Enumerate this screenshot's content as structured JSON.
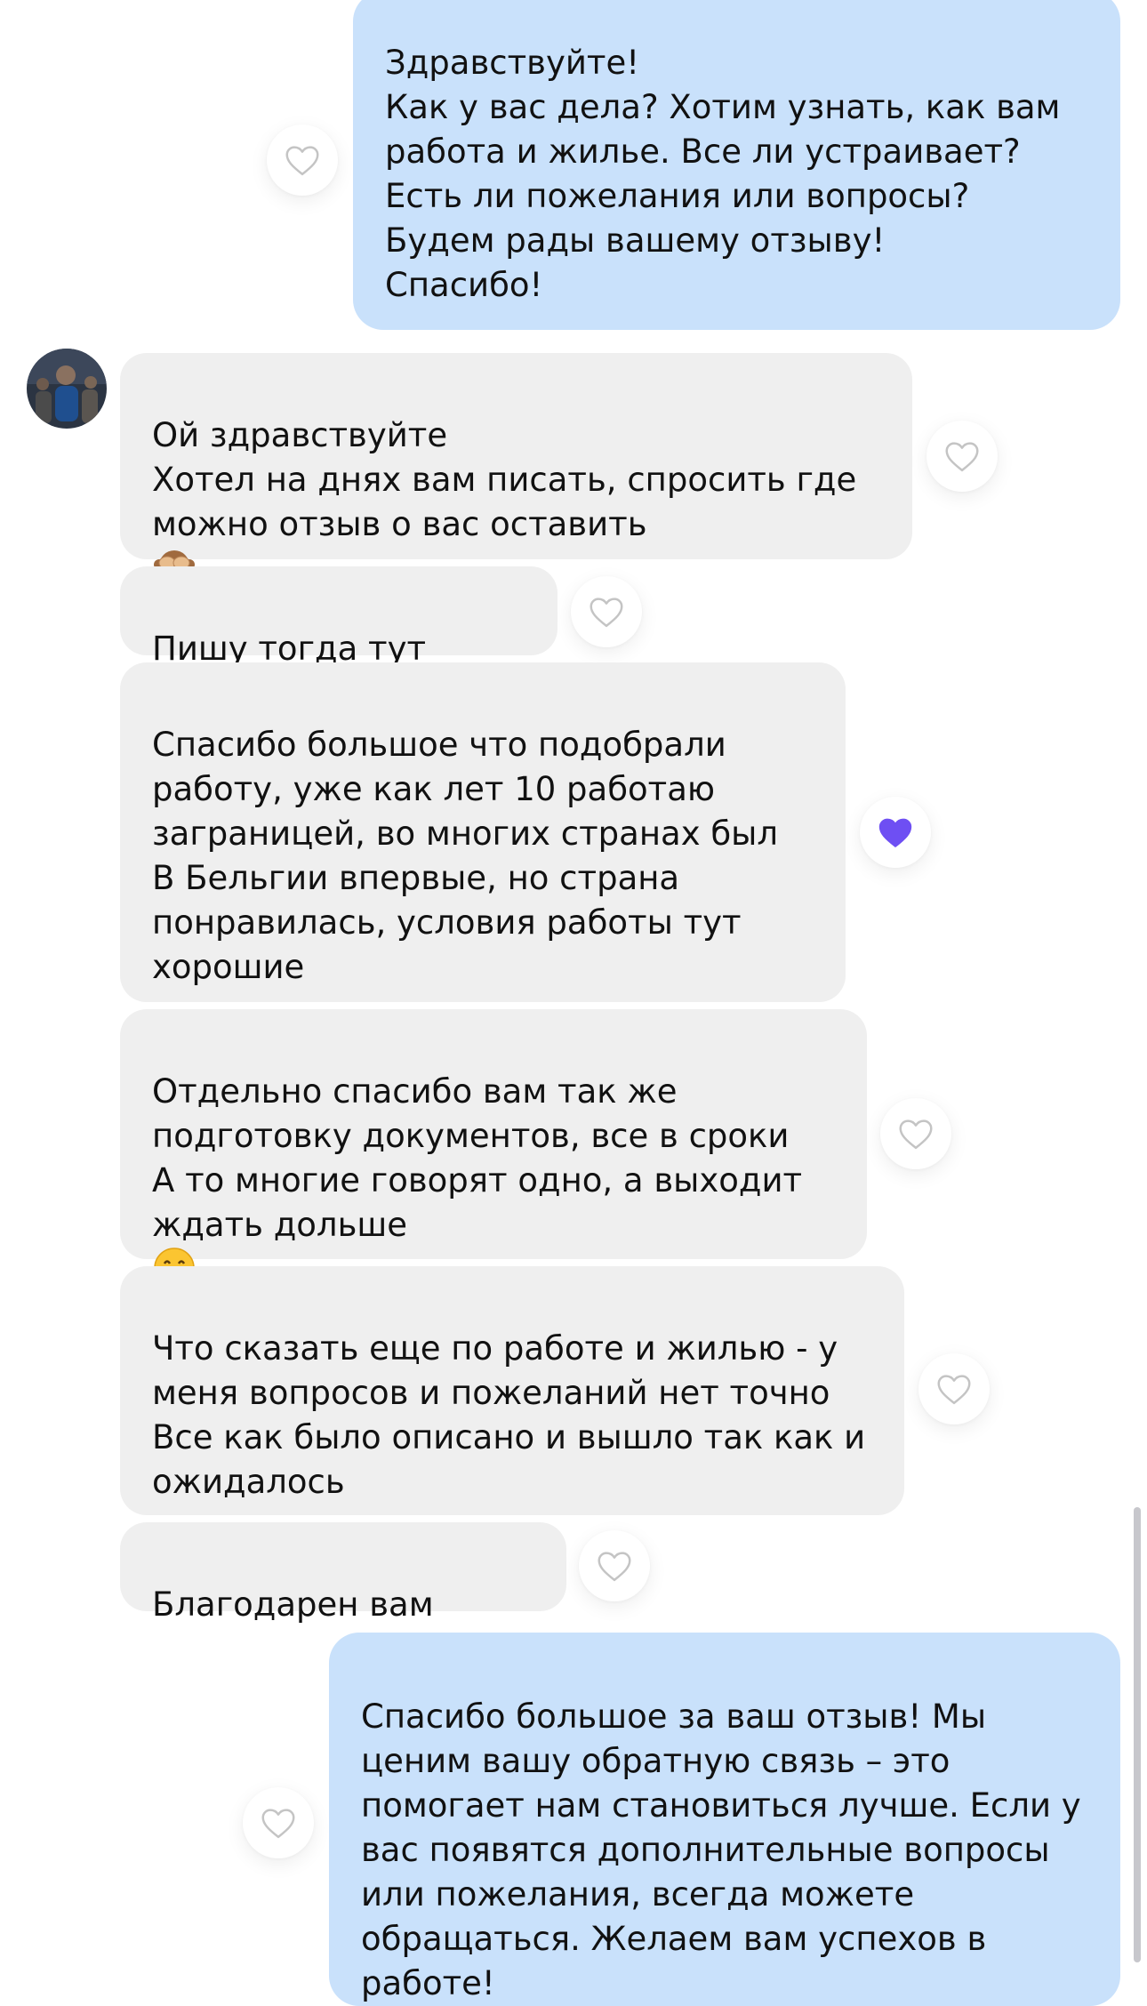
{
  "chat": {
    "messages": [
      {
        "direction": "outgoing",
        "text": "Здравствуйте!\nКак у вас дела? Хотим узнать, как вам работа и жилье. Все ли устраивает?\nЕсть ли пожелания или вопросы?\nБудем рады вашему отзыву!\nСпасибо!",
        "liked": false
      },
      {
        "direction": "incoming",
        "text": "Ой здравствуйте\nХотел на днях вам писать, спросить где можно отзыв о вас оставить",
        "trailing_emoji": "see-no-evil-monkey",
        "liked": false
      },
      {
        "direction": "incoming",
        "text": "Пишу тогда тут",
        "liked": false
      },
      {
        "direction": "incoming",
        "text": "Спасибо большое что подобрали работу, уже как лет 10 работаю заграницей, во многих странах был\nВ Бельгии впервые, но страна понравилась, условия работы тут хорошие",
        "liked": true,
        "like_color": "#6e4ff3"
      },
      {
        "direction": "incoming",
        "text": "Отдельно спасибо вам так же подготовку документов, все в сроки\nА то многие говорят одно, а выходит ждать дольше",
        "trailing_emoji": "grinning-face",
        "liked": false
      },
      {
        "direction": "incoming",
        "text": "Что сказать еще по работе и жилью - у меня вопросов и пожеланий нет точно\nВсе как было описано и вышло так как и ожидалось",
        "liked": false
      },
      {
        "direction": "incoming",
        "text": "Благодарен вам",
        "liked": false
      },
      {
        "direction": "outgoing",
        "text": "Спасибо большое за ваш отзыв! Мы ценим вашу обратную связь – это помогает нам становиться лучше. Если у вас появятся дополнительные вопросы или пожелания, всегда можете обращаться. Желаем вам успехов в работе!",
        "liked": false
      }
    ]
  },
  "colors": {
    "incoming_bubble": "#efefef",
    "outgoing_bubble": "#c9e1fb",
    "heart_outline": "#c4c4c4",
    "heart_liked": "#6e4ff3"
  }
}
